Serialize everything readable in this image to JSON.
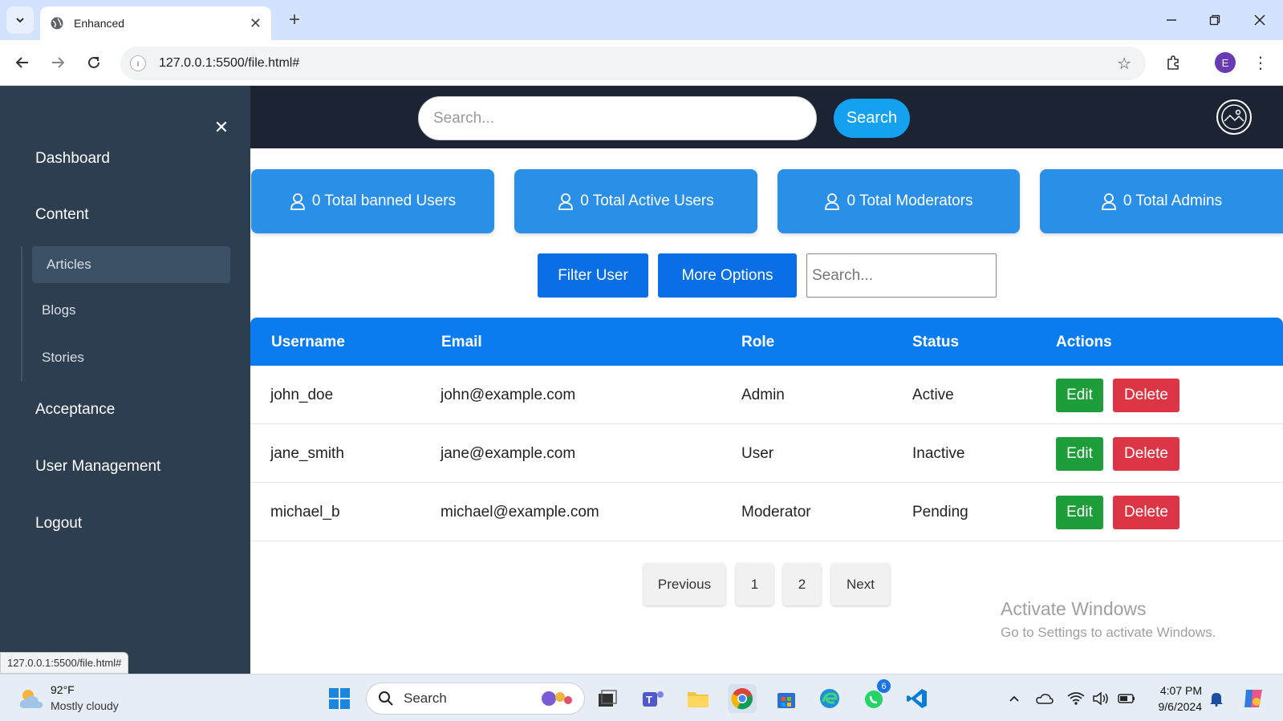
{
  "browser": {
    "tab_title": "Enhanced",
    "url": "127.0.0.1:5500/file.html#",
    "profile_initial": "E",
    "status_url": "127.0.0.1:5500/file.html#"
  },
  "sidebar": {
    "items": [
      {
        "label": "Dashboard"
      },
      {
        "label": "Content"
      },
      {
        "label": "Acceptance"
      },
      {
        "label": "User Management"
      },
      {
        "label": "Logout"
      }
    ],
    "subitems": [
      {
        "label": "Articles",
        "active": true
      },
      {
        "label": "Blogs"
      },
      {
        "label": "Stories"
      }
    ]
  },
  "header": {
    "search_placeholder": "Search...",
    "search_button": "Search"
  },
  "stats": [
    {
      "label": "0 Total banned Users"
    },
    {
      "label": "0 Total Active Users"
    },
    {
      "label": "0 Total Moderators"
    },
    {
      "label": "0 Total Admins"
    }
  ],
  "filters": {
    "filter_button": "Filter User",
    "more_button": "More Options",
    "search_placeholder": "Search..."
  },
  "table": {
    "columns": [
      "Username",
      "Email",
      "Role",
      "Status",
      "Actions"
    ],
    "rows": [
      {
        "username": "john_doe",
        "email": "john@example.com",
        "role": "Admin",
        "status": "Active"
      },
      {
        "username": "jane_smith",
        "email": "jane@example.com",
        "role": "User",
        "status": "Inactive"
      },
      {
        "username": "michael_b",
        "email": "michael@example.com",
        "role": "Moderator",
        "status": "Pending"
      }
    ],
    "edit_label": "Edit",
    "delete_label": "Delete"
  },
  "pagination": {
    "previous": "Previous",
    "pages": [
      "1",
      "2"
    ],
    "next": "Next"
  },
  "watermark": {
    "title": "Activate Windows",
    "subtitle": "Go to Settings to activate Windows."
  },
  "taskbar": {
    "weather_temp": "92°F",
    "weather_desc": "Mostly cloudy",
    "search_label": "Search",
    "whatsapp_badge": "6",
    "time": "4:07 PM",
    "date": "9/6/2024"
  },
  "colors": {
    "sidebar_bg": "#2c3e50",
    "header_bg": "#1c2333",
    "stat_card": "#2a8fe6",
    "table_head": "#0a7cf0",
    "edit": "#1e9e3a",
    "delete": "#dc3545"
  }
}
